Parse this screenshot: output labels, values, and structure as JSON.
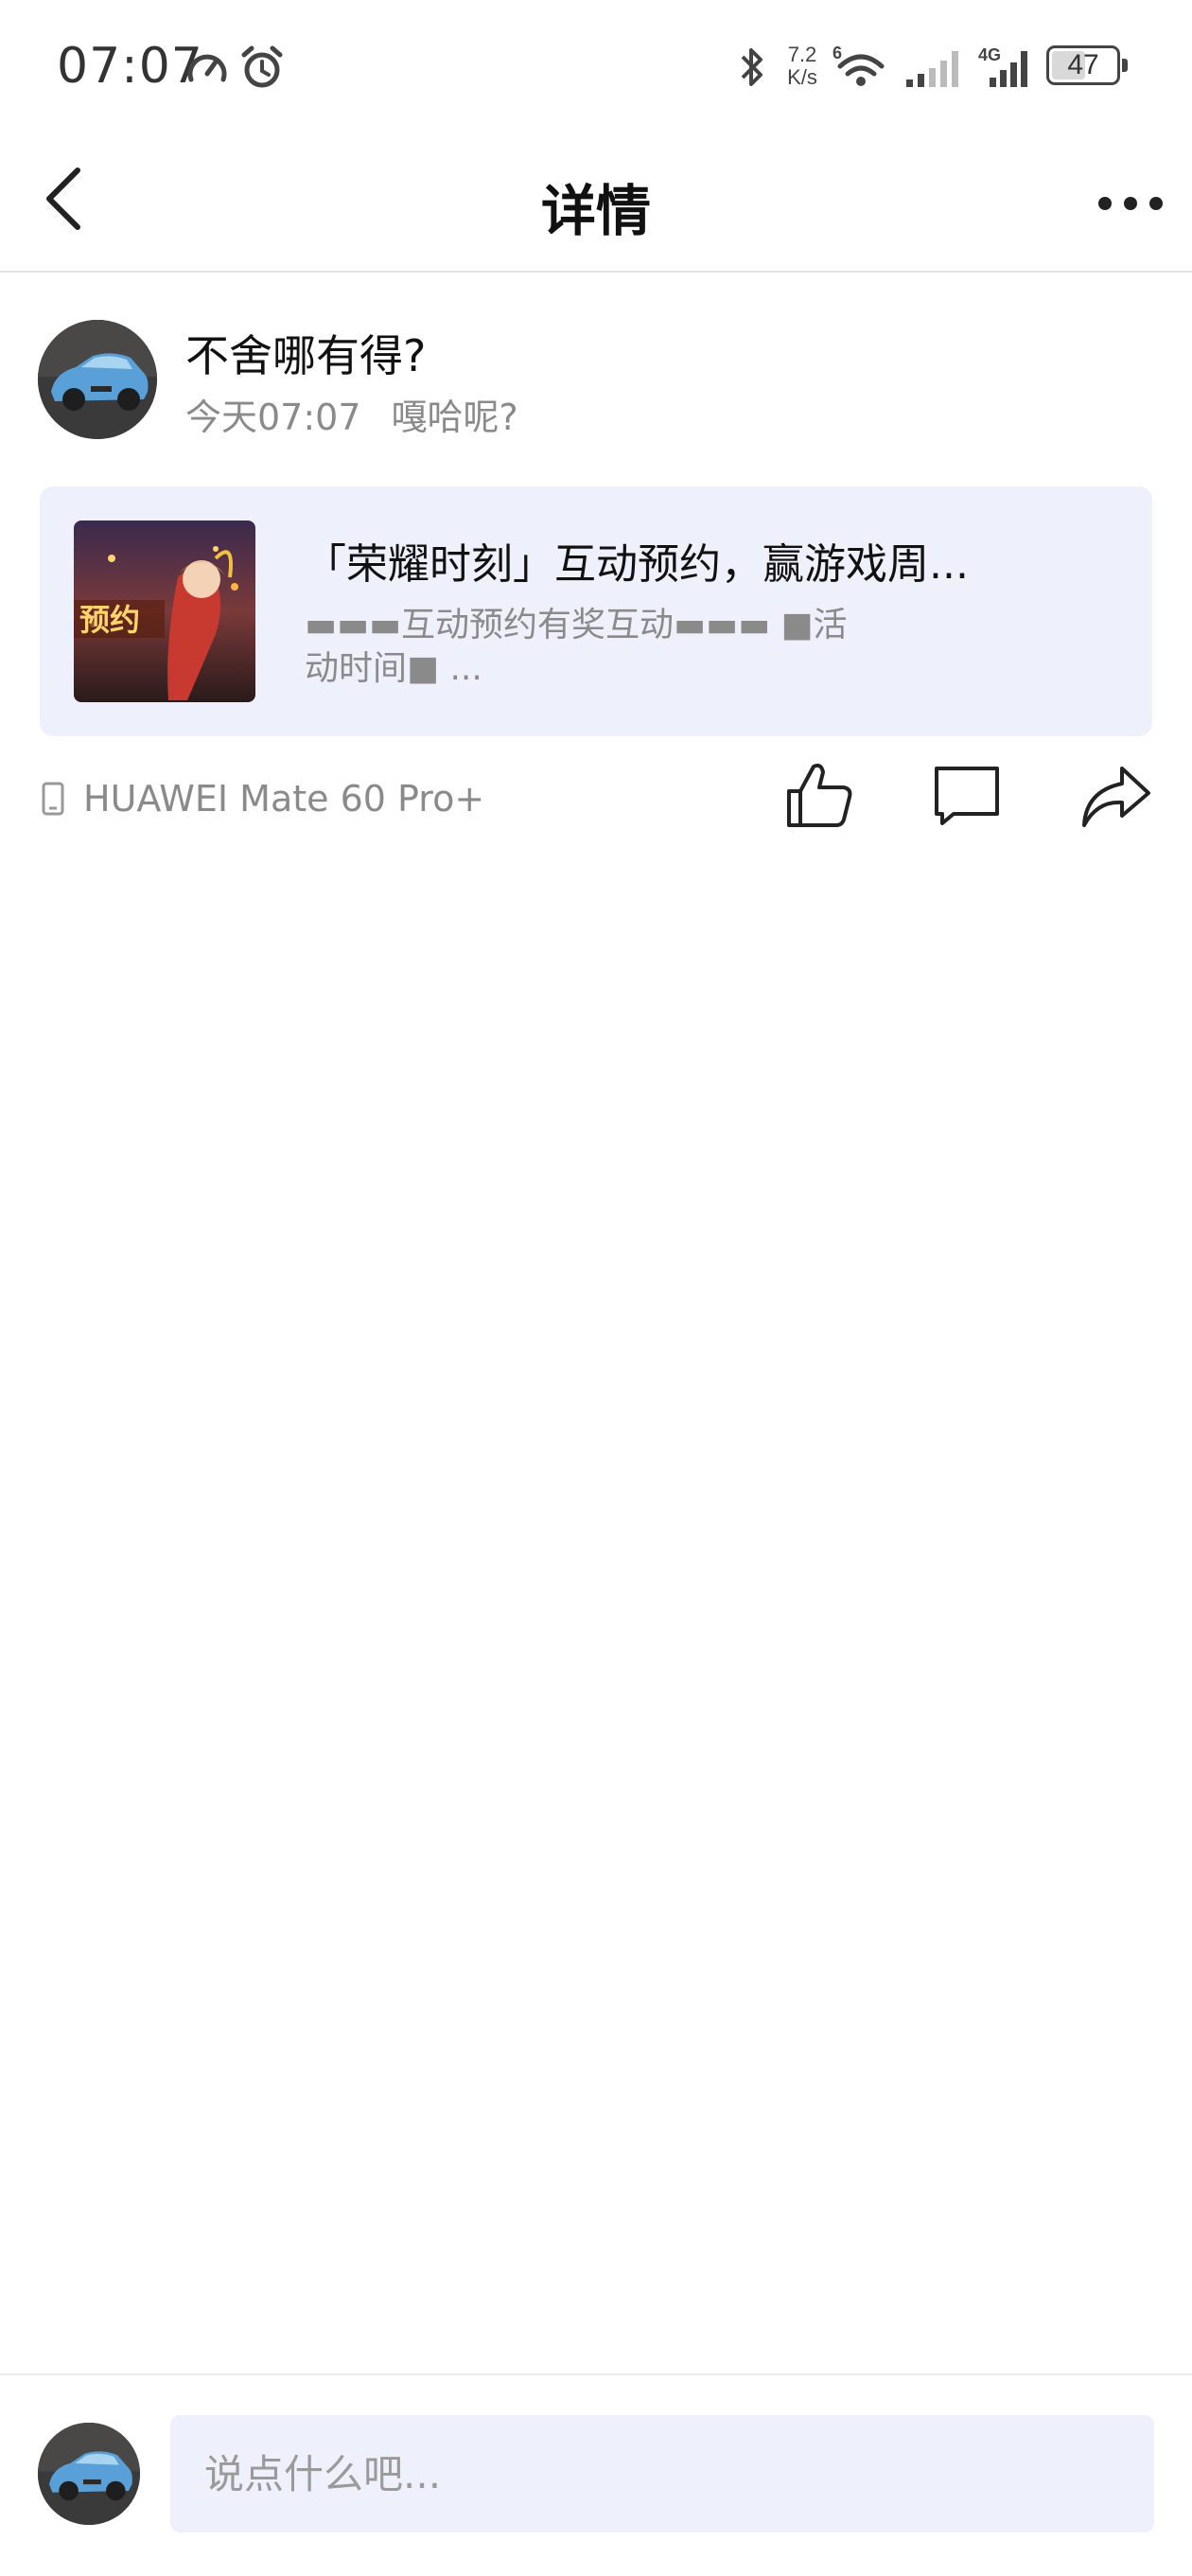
{
  "status_bar": {
    "time": "07:07",
    "net_speed_value": "7.2",
    "net_speed_unit": "K/s",
    "wifi_label": "6",
    "cell_label": "4G",
    "battery": "47"
  },
  "nav": {
    "title": "详情"
  },
  "post": {
    "author": "不舍哪有得?",
    "time": "今天07:07",
    "content": "嘎哈呢?",
    "device": "HUAWEI Mate 60 Pro+"
  },
  "shared_card": {
    "title": "「荣耀时刻」互动预约，赢游戏周...",
    "description": "▬▬▬互动预约有奖互动▬▬▬ ■活动时间■ ...",
    "thumb_text": "预约"
  },
  "actions": {
    "like_icon": "thumbs-up-icon",
    "comment_icon": "comment-icon",
    "share_icon": "share-icon"
  },
  "comment_bar": {
    "placeholder": "说点什么吧..."
  },
  "colors": {
    "card_background": "#eef1fc",
    "secondary_text": "#8a8a8a",
    "primary_text": "#111111"
  }
}
